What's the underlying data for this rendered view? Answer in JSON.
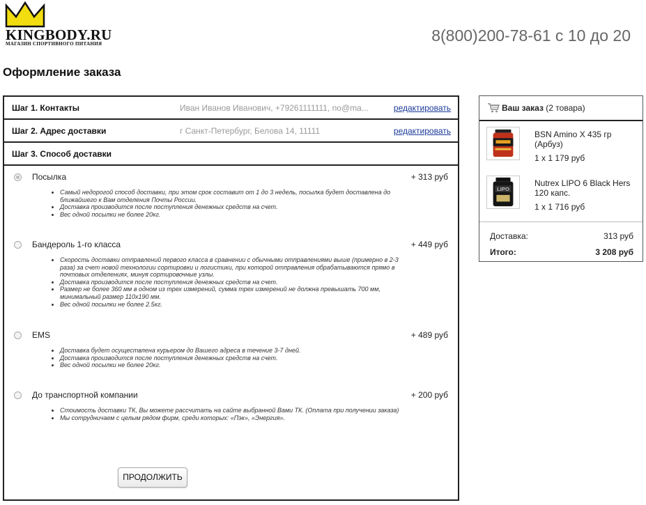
{
  "header": {
    "logo_text": "KINGBODY.RU",
    "logo_sub": "МАГАЗИН СПОРТИВНОГО ПИТАНИЯ",
    "phone": "8(800)200-78-61 с 10 до 20"
  },
  "page_title": "Оформление заказа",
  "steps": [
    {
      "label": "Шаг 1. Контакты",
      "value": "Иван Иванов Иванович, +79261111111, no@ma...",
      "edit": "редактировать"
    },
    {
      "label": "Шаг 2. Адрес доставки",
      "value": "г Санкт-Петербург, Белова 14, 11111",
      "edit": "редактировать"
    },
    {
      "label": "Шаг 3. Способ доставки"
    }
  ],
  "delivery_options": [
    {
      "name": "Посылка",
      "price": "+ 313 руб",
      "selected": true,
      "notes": [
        "Самый недорогой способ доставки, при этом срок составит от 1 до 3 недель, посылка будет доставлена до ближайшего к Вам отделения Почты России.",
        "Доставка производится после поступления денежных средств на счет.",
        "Вес одной посылки не более 20кг."
      ]
    },
    {
      "name": "Бандероль 1-го класса",
      "price": "+ 449 руб",
      "selected": false,
      "notes": [
        "Скорость доставки отправлений первого класса в сравнении с обычными отправлениями выше (примерно в 2-3 раза) за счет новой технологии сортировки и логистики, при которой отправления обрабатываются прямо в почтовых отделениях, минуя сортировочные узлы.",
        "Доставка производится после поступления денежных средств на счет.",
        "Размер не более 360 мм в одном из трех измерений, сумма трех измерений не должна превышать 700 мм, минимальный размер 110x190 мм.",
        "Вес одной посылки не более 2.5кг."
      ]
    },
    {
      "name": "EMS",
      "price": "+ 489 руб",
      "selected": false,
      "notes": [
        "Доставка будет осуществлена курьером до Вашего адреса в течение 3-7 дней.",
        "Доставка производится после поступления денежных средств на счет.",
        "Вес одной посылки не более 20кг."
      ]
    },
    {
      "name": "До транспортной компании",
      "price": "+ 200 руб",
      "selected": false,
      "notes": [
        "Стоимость доставки ТК, Вы можете рассчитать на сайте выбранной Вами ТК. (Оплата при получении заказа)",
        "Мы сотрудничаем с целым рядом фирм, среди которых: «Пэк», «Энергия»."
      ]
    }
  ],
  "continue_label": "ПРОДОЛЖИТЬ",
  "order": {
    "title_bold": "Ваш заказ",
    "title_count": "(2 товара)",
    "items": [
      {
        "name": "BSN Amino X 435 гр (Арбуз)",
        "qty": "1 x 1 179 руб"
      },
      {
        "name": "Nutrex LIPO 6 Black Hers 120 капс.",
        "qty": "1 x 1 716 руб"
      }
    ],
    "delivery_label": "Доставка:",
    "delivery_value": "313 руб",
    "total_label": "Итого:",
    "total_value": "3 208 руб"
  },
  "colors": {
    "link": "#1a3a9a",
    "logo_crown": "#f2dd10",
    "phone": "#666666"
  }
}
